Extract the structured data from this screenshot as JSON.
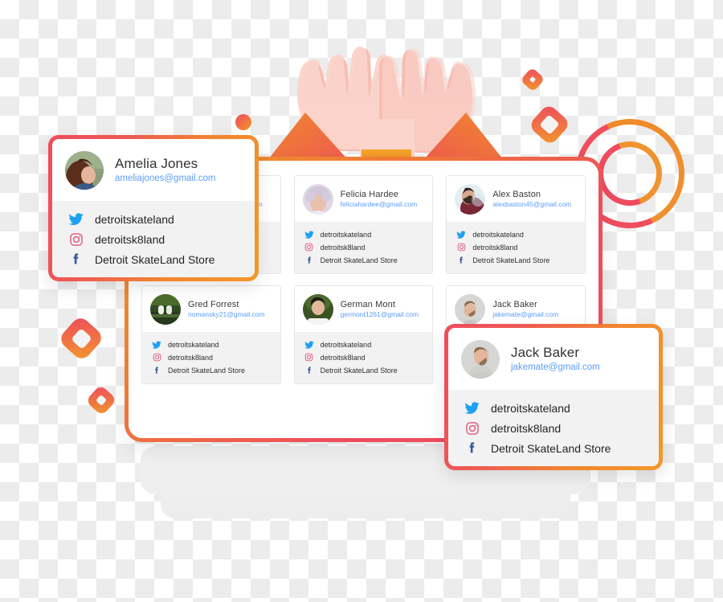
{
  "colors": {
    "gradient_start": "#f0942c",
    "gradient_mid": "#ef7a36",
    "gradient_end": "#ee4b5f",
    "twitter_blue": "#1da1f2",
    "instagram_pink": "#e4567e",
    "facebook_blue": "#3b5998",
    "email_link": "#5b9df9",
    "card_body_grey": "#f2f2f2"
  },
  "illustration": {
    "name": "high-five-hands-envelope",
    "skin_light": "#fbd4cb",
    "skin_dark": "#f6b7ad",
    "envelope_orange": "#f08b2c",
    "envelope_red": "#ee5a4e"
  },
  "social_labels": {
    "twitter": "detroitskateland",
    "instagram": "detroitsk8land",
    "facebook": "Detroit SkateLand Store"
  },
  "contacts": [
    {
      "name": "Amelia Jones",
      "email": "ameliajones@gmail.com",
      "twitter": "detroitskateland",
      "instagram": "detroitsk8land",
      "facebook": "Detroit SkateLand Store",
      "avatar": "woman-long-hair"
    },
    {
      "name": "Felicia Hardee",
      "email": "feliciahardee@gmail.com",
      "twitter": "detroitskateland",
      "instagram": "detroitsk8land",
      "facebook": "Detroit SkateLand Store",
      "avatar": "woman-curly-hair"
    },
    {
      "name": "Alex Baston",
      "email": "alexbaston45@gmail.com",
      "twitter": "detroitskateland",
      "instagram": "detroitsk8land",
      "facebook": "Detroit SkateLand Store",
      "avatar": "man-beard-maroon"
    },
    {
      "name": "Gred Forrest",
      "email": "nomansky21@gmail.com",
      "twitter": "detroitskateland",
      "instagram": "detroitsk8land",
      "facebook": "Detroit SkateLand Store",
      "avatar": "outdoor-shoes-green"
    },
    {
      "name": "German Mont",
      "email": "germont1261@gmail.com",
      "twitter": "detroitskateland",
      "instagram": "detroitsk8land",
      "facebook": "Detroit SkateLand Store",
      "avatar": "young-man-white-shirt"
    },
    {
      "name": "Jack Baker",
      "email": "jakemate@gmail.com",
      "twitter": "detroitskateland",
      "instagram": "detroitsk8land",
      "facebook": "Detroit SkateLand Store",
      "avatar": "man-grey-shirt"
    }
  ],
  "popups": [
    {
      "name": "Amelia Jones",
      "email": "ameliajones@gmail.com",
      "twitter": "detroitskateland",
      "instagram": "detroitsk8land",
      "facebook": "Detroit SkateLand Store"
    },
    {
      "name": "Jack Baker",
      "email": "jakemate@gmail.com",
      "twitter": "detroitskateland",
      "instagram": "detroitsk8land",
      "facebook": "Detroit SkateLand Store"
    }
  ]
}
